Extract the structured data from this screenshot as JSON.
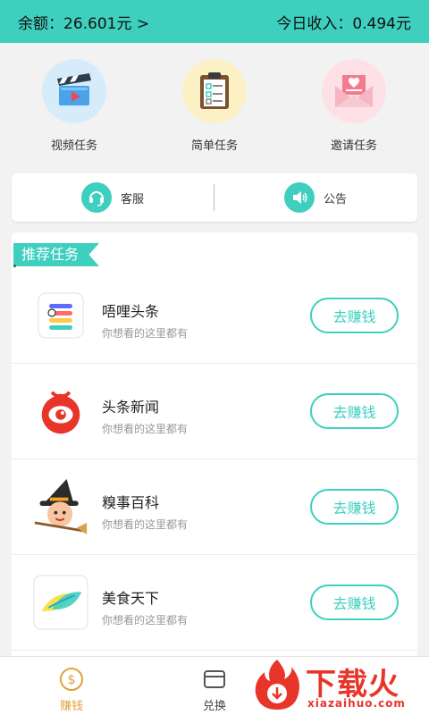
{
  "header": {
    "balance": "余额：26.601元 >",
    "today_income": "今日收入：0.494元"
  },
  "quick_actions": [
    {
      "label": "视频任务",
      "icon": "video-clapper-icon",
      "bg": "#d7ecfb"
    },
    {
      "label": "简单任务",
      "icon": "clipboard-icon",
      "bg": "#fbf1c4"
    },
    {
      "label": "邀请任务",
      "icon": "envelope-heart-icon",
      "bg": "#fde1e6"
    }
  ],
  "service_bar": {
    "service_label": "客服",
    "notice_label": "公告"
  },
  "recommended": {
    "title": "推荐任务",
    "tasks": [
      {
        "name": "唔哩头条",
        "desc": "你想看的这里都有",
        "button": "去赚钱",
        "icon": "list-app-icon"
      },
      {
        "name": "头条新闻",
        "desc": "你想看的这里都有",
        "button": "去赚钱",
        "icon": "red-eye-app-icon"
      },
      {
        "name": "糗事百科",
        "desc": "你想看的这里都有",
        "button": "去赚钱",
        "icon": "witch-app-icon"
      },
      {
        "name": "美食天下",
        "desc": "你想看的这里都有",
        "button": "去赚钱",
        "icon": "leaf-app-icon"
      }
    ]
  },
  "tabbar": {
    "earn": "赚钱",
    "exchange": "兑换"
  },
  "watermark": {
    "zh": "下载火",
    "en": "xiazaihuo.com"
  },
  "colors": {
    "accent": "#3ecfbf",
    "brand_red": "#e8352a"
  }
}
